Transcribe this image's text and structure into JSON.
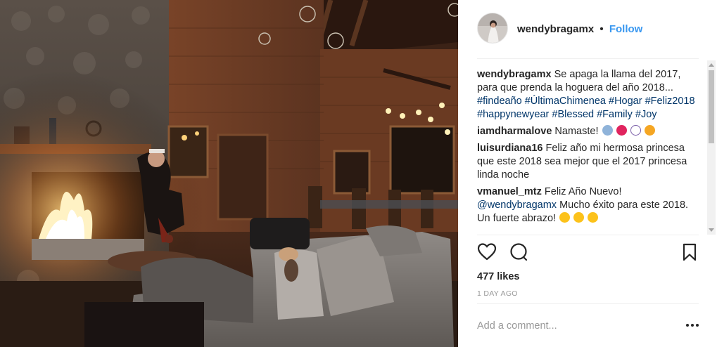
{
  "post": {
    "username": "wendybragamx",
    "separator": "•",
    "follow_label": "Follow"
  },
  "comments": [
    {
      "user": "wendybragamx",
      "text": "Se apaga la llama del 2017, para que prenda la hoguera del año 2018...",
      "hashtags": [
        "#findeaño",
        "#ÚltimaChimenea",
        "#Hogar",
        "#Feliz2018",
        "#happynewyear",
        "#Blessed",
        "#Family",
        "#Joy"
      ]
    },
    {
      "user": "iamdharmalove",
      "text": "Namaste!",
      "emojis": [
        "praying-woman",
        "red-heart",
        "om-symbol",
        "raised-hands"
      ]
    },
    {
      "user": "luisurdiana16",
      "text": "Feliz año mi hermosa princesa que este 2018 sea mejor que el 2017 princesa linda noche"
    },
    {
      "user": "vmanuel_mtz",
      "text": "Feliz Año Nuevo!",
      "mention": "@wendybragamx",
      "text2": "Mucho éxito para este 2018. Un fuerte abrazo!",
      "emojis": [
        "smile",
        "smile",
        "smile"
      ]
    }
  ],
  "stats": {
    "likes": "477 likes",
    "time": "1 DAY AGO"
  },
  "compose": {
    "placeholder": "Add a comment..."
  },
  "icons": {
    "like": "heart-outline-icon",
    "comment": "speech-bubble-icon",
    "save": "bookmark-icon",
    "more": "ellipsis-icon"
  },
  "colors": {
    "link": "#3897f0",
    "hashtag": "#003569",
    "muted": "#999999"
  }
}
